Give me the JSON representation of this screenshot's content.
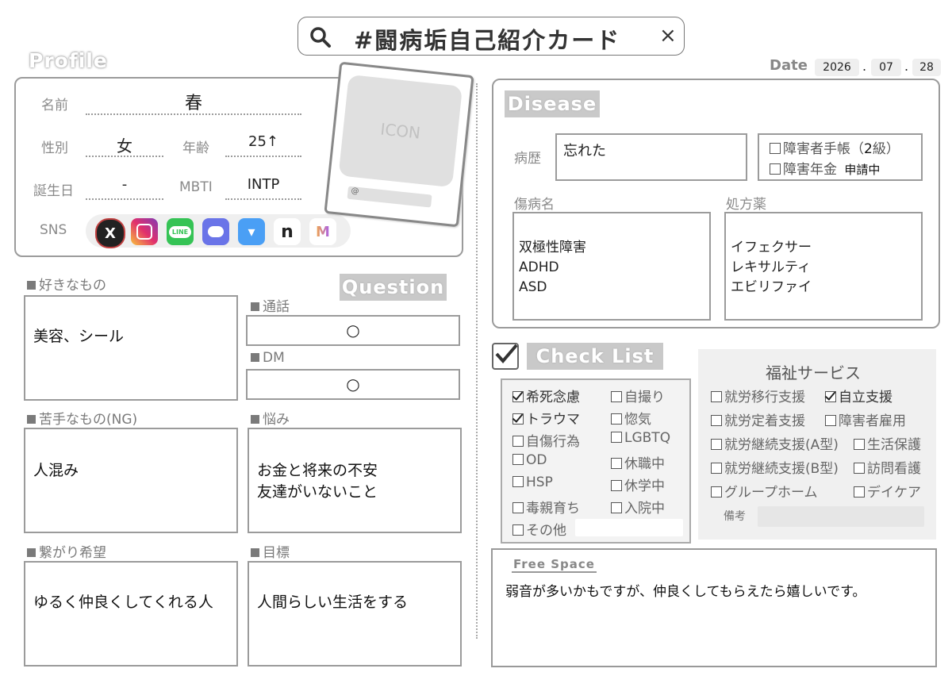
{
  "search": {
    "text": "#闘病垢自己紹介カード",
    "close_label": "×"
  },
  "date": {
    "label": "Date",
    "year": "2026",
    "month": "07",
    "day": "28",
    "sep": "."
  },
  "profile": {
    "badge": "Profile",
    "name_label": "名前",
    "name": "春",
    "gender_label": "性別",
    "gender": "女",
    "age_label": "年齢",
    "age": "25↑",
    "birthday_label": "誕生日",
    "birthday": "-",
    "mbti_label": "MBTI",
    "mbti": "INTP",
    "sns_label": "SNS",
    "sns_icons": [
      "x-icon",
      "instagram-icon",
      "line-icon",
      "discord-icon",
      "bluesky-icon",
      "note-icon",
      "misskey-icon"
    ],
    "icon_placeholder": "ICON",
    "icon_at": "@"
  },
  "question_badge": "Question",
  "likes": {
    "label": "好きなもの",
    "text": "美容、シール"
  },
  "call": {
    "label": "通話",
    "value": "○"
  },
  "dm": {
    "label": "DM",
    "value": "○"
  },
  "dislikes": {
    "label": "苦手なもの(NG)",
    "text": "人混み"
  },
  "worries": {
    "label": "悩み",
    "text": "お金と将来の不安\n友達がいないこと"
  },
  "connect": {
    "label": "繋がり希望",
    "text": "ゆるく仲良くしてくれる人"
  },
  "goal": {
    "label": "目標",
    "text": "人間らしい生活をする"
  },
  "disease": {
    "badge": "Disease",
    "history_label": "病歴",
    "history": "忘れた",
    "techo_label": "障害者手帳",
    "techo_grade_open": "（",
    "techo_grade": "2",
    "techo_grade_close": "級）",
    "pension_label": "障害年金",
    "pension_status": "申請中",
    "diag_label": "傷病名",
    "diagnoses": "双極性障害\nADHD\nASD",
    "meds_label": "処方薬",
    "meds": "イフェクサー\nレキサルティ\nエビリファイ"
  },
  "checklist": {
    "badge": "Check List",
    "left": [
      {
        "label": "希死念慮",
        "checked": true
      },
      {
        "label": "トラウマ",
        "checked": true
      },
      {
        "label": "自傷行為",
        "checked": false
      },
      {
        "label": "OD",
        "checked": false
      },
      {
        "label": "HSP",
        "checked": false
      },
      {
        "label": "毒親育ち",
        "checked": false
      },
      {
        "label": "その他",
        "checked": false
      }
    ],
    "right": [
      {
        "label": "自撮り",
        "checked": false
      },
      {
        "label": "惚気",
        "checked": false
      },
      {
        "label": "LGBTQ",
        "checked": false
      },
      {
        "label": "休職中",
        "checked": false
      },
      {
        "label": "休学中",
        "checked": false
      },
      {
        "label": "入院中",
        "checked": false
      }
    ]
  },
  "welfare": {
    "title": "福祉サービス",
    "items": [
      {
        "label": "就労移行支援",
        "checked": false
      },
      {
        "label": "自立支援",
        "checked": true
      },
      {
        "label": "就労定着支援",
        "checked": false
      },
      {
        "label": "障害者雇用",
        "checked": false
      },
      {
        "label": "就労継続支援(A型)",
        "checked": false
      },
      {
        "label": "生活保護",
        "checked": false
      },
      {
        "label": "就労継続支援(B型)",
        "checked": false
      },
      {
        "label": "訪問看護",
        "checked": false
      },
      {
        "label": "グループホーム",
        "checked": false
      },
      {
        "label": "デイケア",
        "checked": false
      }
    ],
    "notes_label": "備考"
  },
  "free_space": {
    "label": "Free Space",
    "text": "弱音が多いかもですが、仲良くしてもらえたら嬉しいです。"
  }
}
